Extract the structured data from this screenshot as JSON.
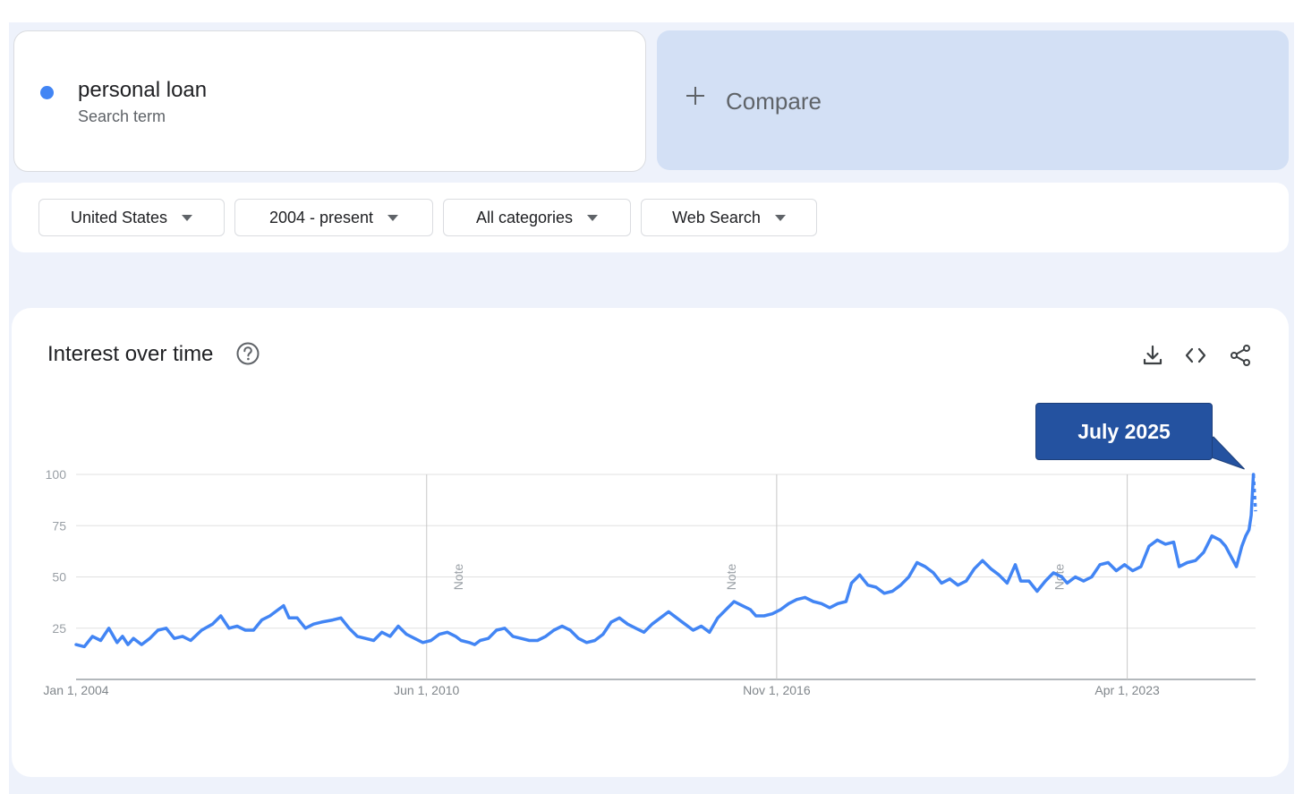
{
  "search_term": {
    "name": "personal loan",
    "type": "Search term",
    "color": "#4285f4"
  },
  "compare": {
    "label": "Compare"
  },
  "filters": {
    "region": "United States",
    "time": "2004 - present",
    "category": "All categories",
    "property": "Web Search"
  },
  "chart_panel": {
    "title": "Interest over time",
    "icons": [
      "help-icon",
      "download-icon",
      "embed-code-icon",
      "share-icon"
    ]
  },
  "tooltip": {
    "label": "July 2025",
    "color": "#2452a0"
  },
  "chart_data": {
    "type": "line",
    "title": "Interest over time",
    "xlabel": "",
    "ylabel": "",
    "ylim": [
      0,
      100
    ],
    "y_ticks": [
      25,
      50,
      75,
      100
    ],
    "x_range": [
      2004.0,
      2025.6
    ],
    "x_tick_labels": [
      {
        "label": "Jan 1, 2004",
        "x": 2004.0
      },
      {
        "label": "Jun 1, 2010",
        "x": 2010.42
      },
      {
        "label": "Nov 1, 2016",
        "x": 2016.83
      },
      {
        "label": "Apr 1, 2023",
        "x": 2023.25
      }
    ],
    "notes": [
      {
        "label": "Note",
        "x": 2011.0
      },
      {
        "label": "Note",
        "x": 2016.0
      },
      {
        "label": "Note",
        "x": 2022.0
      }
    ],
    "grid": true,
    "line_color": "#4285f4",
    "series": [
      {
        "name": "personal loan",
        "points": [
          [
            2004.0,
            17
          ],
          [
            2004.15,
            16
          ],
          [
            2004.3,
            21
          ],
          [
            2004.45,
            19
          ],
          [
            2004.6,
            25
          ],
          [
            2004.75,
            18
          ],
          [
            2004.85,
            21
          ],
          [
            2004.95,
            17
          ],
          [
            2005.05,
            20
          ],
          [
            2005.2,
            17
          ],
          [
            2005.35,
            20
          ],
          [
            2005.5,
            24
          ],
          [
            2005.65,
            25
          ],
          [
            2005.8,
            20
          ],
          [
            2005.95,
            21
          ],
          [
            2006.1,
            19
          ],
          [
            2006.3,
            24
          ],
          [
            2006.5,
            27
          ],
          [
            2006.65,
            31
          ],
          [
            2006.8,
            25
          ],
          [
            2006.95,
            26
          ],
          [
            2007.1,
            24
          ],
          [
            2007.25,
            24
          ],
          [
            2007.4,
            29
          ],
          [
            2007.55,
            31
          ],
          [
            2007.7,
            34
          ],
          [
            2007.8,
            36
          ],
          [
            2007.9,
            30
          ],
          [
            2008.05,
            30
          ],
          [
            2008.2,
            25
          ],
          [
            2008.35,
            27
          ],
          [
            2008.5,
            28
          ],
          [
            2008.7,
            29
          ],
          [
            2008.85,
            30
          ],
          [
            2009.0,
            25
          ],
          [
            2009.15,
            21
          ],
          [
            2009.3,
            20
          ],
          [
            2009.45,
            19
          ],
          [
            2009.6,
            23
          ],
          [
            2009.75,
            21
          ],
          [
            2009.9,
            26
          ],
          [
            2010.05,
            22
          ],
          [
            2010.2,
            20
          ],
          [
            2010.35,
            18
          ],
          [
            2010.5,
            19
          ],
          [
            2010.65,
            22
          ],
          [
            2010.8,
            23
          ],
          [
            2010.95,
            21
          ],
          [
            2011.05,
            19
          ],
          [
            2011.2,
            18
          ],
          [
            2011.3,
            17
          ],
          [
            2011.4,
            19
          ],
          [
            2011.55,
            20
          ],
          [
            2011.7,
            24
          ],
          [
            2011.85,
            25
          ],
          [
            2012.0,
            21
          ],
          [
            2012.15,
            20
          ],
          [
            2012.3,
            19
          ],
          [
            2012.45,
            19
          ],
          [
            2012.6,
            21
          ],
          [
            2012.75,
            24
          ],
          [
            2012.9,
            26
          ],
          [
            2013.05,
            24
          ],
          [
            2013.2,
            20
          ],
          [
            2013.35,
            18
          ],
          [
            2013.5,
            19
          ],
          [
            2013.65,
            22
          ],
          [
            2013.8,
            28
          ],
          [
            2013.95,
            30
          ],
          [
            2014.1,
            27
          ],
          [
            2014.25,
            25
          ],
          [
            2014.4,
            23
          ],
          [
            2014.55,
            27
          ],
          [
            2014.7,
            30
          ],
          [
            2014.85,
            33
          ],
          [
            2015.0,
            30
          ],
          [
            2015.15,
            27
          ],
          [
            2015.3,
            24
          ],
          [
            2015.45,
            26
          ],
          [
            2015.6,
            23
          ],
          [
            2015.75,
            30
          ],
          [
            2015.9,
            34
          ],
          [
            2016.05,
            38
          ],
          [
            2016.2,
            36
          ],
          [
            2016.35,
            34
          ],
          [
            2016.45,
            31
          ],
          [
            2016.6,
            31
          ],
          [
            2016.75,
            32
          ],
          [
            2016.9,
            34
          ],
          [
            2017.05,
            37
          ],
          [
            2017.2,
            39
          ],
          [
            2017.35,
            40
          ],
          [
            2017.5,
            38
          ],
          [
            2017.65,
            37
          ],
          [
            2017.8,
            35
          ],
          [
            2017.95,
            37
          ],
          [
            2018.1,
            38
          ],
          [
            2018.2,
            47
          ],
          [
            2018.35,
            51
          ],
          [
            2018.5,
            46
          ],
          [
            2018.65,
            45
          ],
          [
            2018.8,
            42
          ],
          [
            2018.95,
            43
          ],
          [
            2019.1,
            46
          ],
          [
            2019.25,
            50
          ],
          [
            2019.4,
            57
          ],
          [
            2019.55,
            55
          ],
          [
            2019.7,
            52
          ],
          [
            2019.85,
            47
          ],
          [
            2020.0,
            49
          ],
          [
            2020.15,
            46
          ],
          [
            2020.3,
            48
          ],
          [
            2020.45,
            54
          ],
          [
            2020.6,
            58
          ],
          [
            2020.75,
            54
          ],
          [
            2020.9,
            51
          ],
          [
            2021.05,
            47
          ],
          [
            2021.2,
            56
          ],
          [
            2021.3,
            48
          ],
          [
            2021.45,
            48
          ],
          [
            2021.6,
            43
          ],
          [
            2021.75,
            48
          ],
          [
            2021.9,
            52
          ],
          [
            2022.05,
            50
          ],
          [
            2022.15,
            47
          ],
          [
            2022.3,
            50
          ],
          [
            2022.45,
            48
          ],
          [
            2022.6,
            50
          ],
          [
            2022.75,
            56
          ],
          [
            2022.9,
            57
          ],
          [
            2023.05,
            53
          ],
          [
            2023.2,
            56
          ],
          [
            2023.35,
            53
          ],
          [
            2023.5,
            55
          ],
          [
            2023.65,
            65
          ],
          [
            2023.8,
            68
          ],
          [
            2023.95,
            66
          ],
          [
            2024.1,
            67
          ],
          [
            2024.2,
            55
          ],
          [
            2024.35,
            57
          ],
          [
            2024.5,
            58
          ],
          [
            2024.65,
            62
          ],
          [
            2024.8,
            70
          ],
          [
            2024.95,
            68
          ],
          [
            2025.05,
            65
          ],
          [
            2025.15,
            60
          ],
          [
            2025.25,
            55
          ],
          [
            2025.35,
            65
          ],
          [
            2025.42,
            70
          ],
          [
            2025.48,
            73
          ],
          [
            2025.52,
            80
          ],
          [
            2025.56,
            100
          ]
        ]
      }
    ],
    "partial_segment": [
      [
        2025.56,
        100
      ],
      [
        2025.6,
        82
      ]
    ]
  }
}
